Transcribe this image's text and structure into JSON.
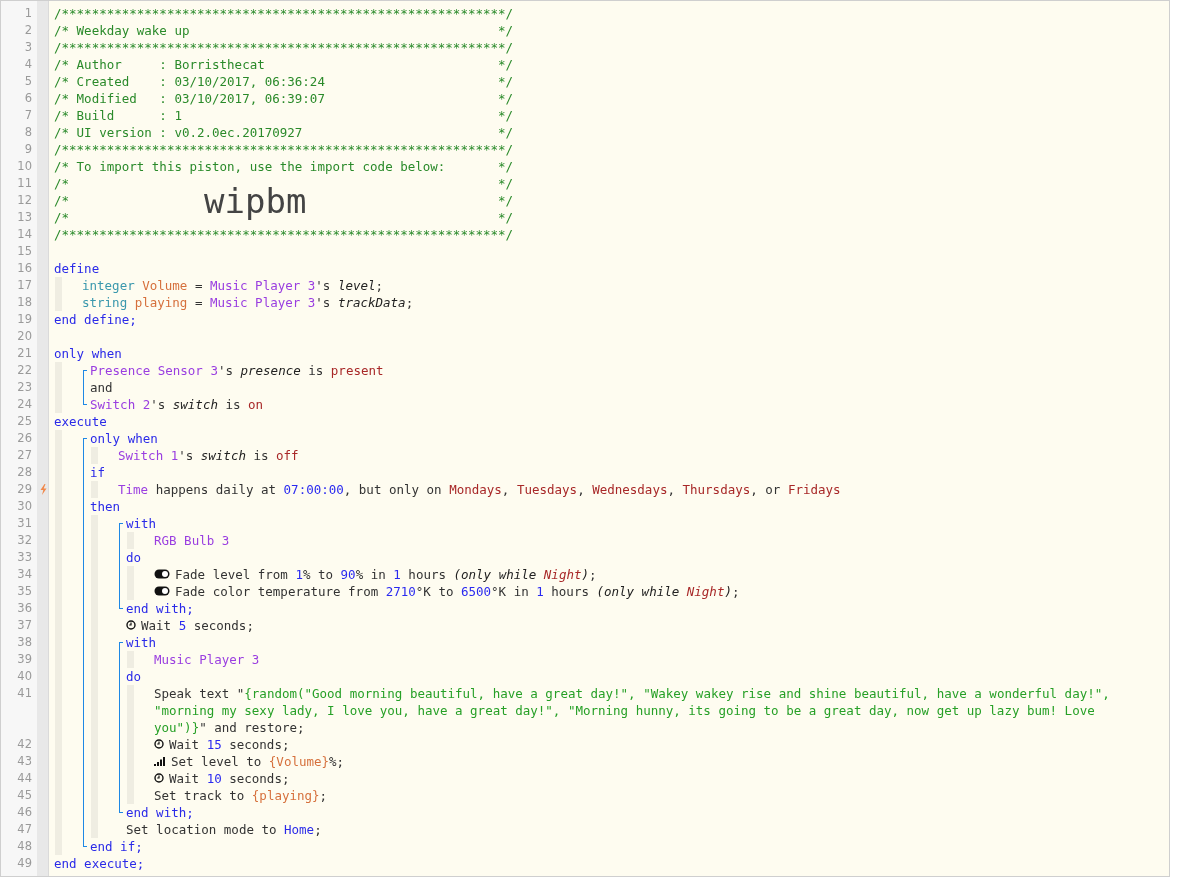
{
  "lines": [
    {
      "kind": "line",
      "n": "1",
      "tokens": [
        {
          "kind": "c",
          "t": "/***********************************************************/"
        }
      ]
    },
    {
      "kind": "banner",
      "n": "2",
      "tokens": [
        {
          "kind": "c",
          "t": "/* Weekday wake up"
        },
        {
          "kind": "c",
          "t": "*/"
        }
      ]
    },
    {
      "kind": "line",
      "n": "3",
      "tokens": [
        {
          "kind": "c",
          "t": "/***********************************************************/"
        }
      ]
    },
    {
      "kind": "banner",
      "n": "4",
      "tokens": [
        {
          "kind": "c",
          "t": "/* Author     : Borristhecat"
        },
        {
          "kind": "c",
          "t": "*/"
        }
      ]
    },
    {
      "kind": "banner",
      "n": "5",
      "tokens": [
        {
          "kind": "c",
          "t": "/* Created    : 03/10/2017, 06:36:24"
        },
        {
          "kind": "c",
          "t": "*/"
        }
      ]
    },
    {
      "kind": "banner",
      "n": "6",
      "tokens": [
        {
          "kind": "c",
          "t": "/* Modified   : 03/10/2017, 06:39:07"
        },
        {
          "kind": "c",
          "t": "*/"
        }
      ]
    },
    {
      "kind": "banner",
      "n": "7",
      "tokens": [
        {
          "kind": "c",
          "t": "/* Build      : 1"
        },
        {
          "kind": "c",
          "t": "*/"
        }
      ]
    },
    {
      "kind": "banner",
      "n": "8",
      "tokens": [
        {
          "kind": "c",
          "t": "/* UI version : v0.2.0ec.20170927"
        },
        {
          "kind": "c",
          "t": "*/"
        }
      ]
    },
    {
      "kind": "line",
      "n": "9",
      "tokens": [
        {
          "kind": "c",
          "t": "/***********************************************************/"
        }
      ]
    },
    {
      "kind": "banner",
      "n": "10",
      "tokens": [
        {
          "kind": "c",
          "t": "/* To import this piston, use the import code below:"
        },
        {
          "kind": "c",
          "t": "*/"
        }
      ]
    },
    {
      "kind": "banner",
      "n": "11",
      "tokens": [
        {
          "kind": "c",
          "t": "/*"
        },
        {
          "kind": "c",
          "t": "*/"
        }
      ]
    },
    {
      "kind": "banner",
      "n": "12",
      "tokens": [
        {
          "kind": "c",
          "t": "/*"
        },
        {
          "kind": "big",
          "t": "wipbm"
        },
        {
          "kind": "c",
          "t": "*/"
        }
      ]
    },
    {
      "kind": "banner",
      "n": "13",
      "tokens": [
        {
          "kind": "c",
          "t": "/*"
        },
        {
          "kind": "c",
          "t": "*/"
        }
      ]
    },
    {
      "kind": "line",
      "n": "14",
      "tokens": [
        {
          "kind": "c",
          "t": "/***********************************************************/"
        }
      ]
    },
    {
      "kind": "line",
      "n": "15"
    },
    {
      "kind": "line",
      "n": "16",
      "tokens": [
        {
          "kind": "kw",
          "t": "define"
        }
      ],
      "children": [
        {
          "kind": "line",
          "n": "17",
          "tokens": [
            {
              "kind": "type",
              "t": "integer "
            },
            {
              "kind": "var",
              "t": "Volume"
            },
            {
              "kind": "txt",
              "t": " = "
            },
            {
              "kind": "dev",
              "t": "Music Player 3"
            },
            {
              "kind": "txt",
              "t": "'s "
            },
            {
              "kind": "it",
              "t": "level"
            },
            {
              "kind": "txt",
              "t": ";"
            }
          ]
        },
        {
          "kind": "line",
          "n": "18",
          "tokens": [
            {
              "kind": "type",
              "t": "string "
            },
            {
              "kind": "var",
              "t": "playing"
            },
            {
              "kind": "txt",
              "t": " = "
            },
            {
              "kind": "dev",
              "t": "Music Player 3"
            },
            {
              "kind": "txt",
              "t": "'s "
            },
            {
              "kind": "it",
              "t": "trackData"
            },
            {
              "kind": "txt",
              "t": ";"
            }
          ]
        }
      ]
    },
    {
      "kind": "line",
      "n": "19",
      "tokens": [
        {
          "kind": "kw",
          "t": "end define;"
        }
      ]
    },
    {
      "kind": "line",
      "n": "20"
    },
    {
      "kind": "line",
      "n": "21",
      "tokens": [
        {
          "kind": "kw",
          "t": "only when"
        }
      ],
      "children": [
        {
          "kind": "group",
          "bracket": true,
          "items": [
            {
              "kind": "line",
              "n": "22",
              "tokens": [
                {
                  "kind": "dev",
                  "t": "Presence Sensor 3"
                },
                {
                  "kind": "txt",
                  "t": "'s "
                },
                {
                  "kind": "it",
                  "t": "presence"
                },
                {
                  "kind": "txt",
                  "t": " is "
                },
                {
                  "kind": "val",
                  "t": "present"
                }
              ]
            },
            {
              "kind": "line",
              "n": "23",
              "tokens": [
                {
                  "kind": "txt",
                  "t": "and"
                }
              ]
            },
            {
              "kind": "line",
              "n": "24",
              "tokens": [
                {
                  "kind": "dev",
                  "t": "Switch 2"
                },
                {
                  "kind": "txt",
                  "t": "'s "
                },
                {
                  "kind": "it",
                  "t": "switch"
                },
                {
                  "kind": "txt",
                  "t": " is "
                },
                {
                  "kind": "val",
                  "t": "on"
                }
              ]
            }
          ]
        }
      ]
    },
    {
      "kind": "line",
      "n": "25",
      "tokens": [
        {
          "kind": "kw",
          "t": "execute"
        }
      ],
      "children": [
        {
          "kind": "group",
          "bracket": true,
          "items": [
            {
              "kind": "line",
              "n": "26",
              "tokens": [
                {
                  "kind": "kw",
                  "t": "only when"
                }
              ],
              "children": [
                {
                  "kind": "line",
                  "n": "27",
                  "tokens": [
                    {
                      "kind": "dev",
                      "t": "Switch 1"
                    },
                    {
                      "kind": "txt",
                      "t": "'s "
                    },
                    {
                      "kind": "it",
                      "t": "switch"
                    },
                    {
                      "kind": "txt",
                      "t": " is "
                    },
                    {
                      "kind": "val",
                      "t": "off"
                    }
                  ]
                }
              ]
            },
            {
              "kind": "line",
              "n": "28",
              "tokens": [
                {
                  "kind": "kw",
                  "t": "if"
                }
              ],
              "children": [
                {
                  "kind": "line",
                  "n": "29",
                  "trigger": true,
                  "tokens": [
                    {
                      "kind": "dev",
                      "t": "Time"
                    },
                    {
                      "kind": "txt",
                      "t": " happens daily at "
                    },
                    {
                      "kind": "num",
                      "t": "07:00:00"
                    },
                    {
                      "kind": "txt",
                      "t": ", but only on "
                    },
                    {
                      "kind": "val",
                      "t": "Mondays"
                    },
                    {
                      "kind": "txt",
                      "t": ", "
                    },
                    {
                      "kind": "val",
                      "t": "Tuesdays"
                    },
                    {
                      "kind": "txt",
                      "t": ", "
                    },
                    {
                      "kind": "val",
                      "t": "Wednesdays"
                    },
                    {
                      "kind": "txt",
                      "t": ", "
                    },
                    {
                      "kind": "val",
                      "t": "Thursdays"
                    },
                    {
                      "kind": "txt",
                      "t": ", or "
                    },
                    {
                      "kind": "val",
                      "t": "Fridays"
                    }
                  ]
                }
              ]
            },
            {
              "kind": "line",
              "n": "30",
              "tokens": [
                {
                  "kind": "kw",
                  "t": "then"
                }
              ],
              "children": [
                {
                  "kind": "group",
                  "bracket": true,
                  "items": [
                    {
                      "kind": "line",
                      "n": "31",
                      "tokens": [
                        {
                          "kind": "kw",
                          "t": "with"
                        }
                      ],
                      "children": [
                        {
                          "kind": "line",
                          "n": "32",
                          "tokens": [
                            {
                              "kind": "dev",
                              "t": "RGB Bulb 3"
                            }
                          ]
                        }
                      ]
                    },
                    {
                      "kind": "line",
                      "n": "33",
                      "tokens": [
                        {
                          "kind": "kw",
                          "t": "do"
                        }
                      ],
                      "children": [
                        {
                          "kind": "line",
                          "n": "34",
                          "tokens": [
                            {
                              "kind": "icon_toggle"
                            },
                            {
                              "kind": "txt",
                              "t": "Fade level from "
                            },
                            {
                              "kind": "num",
                              "t": "1"
                            },
                            {
                              "kind": "txt",
                              "t": "% to "
                            },
                            {
                              "kind": "num",
                              "t": "90"
                            },
                            {
                              "kind": "txt",
                              "t": "% in "
                            },
                            {
                              "kind": "num",
                              "t": "1"
                            },
                            {
                              "kind": "txt",
                              "t": " hours "
                            },
                            {
                              "kind": "it",
                              "t": "(only while "
                            },
                            {
                              "kind": "itval",
                              "t": "Night"
                            },
                            {
                              "kind": "it",
                              "t": ")"
                            },
                            {
                              "kind": "txt",
                              "t": ";"
                            }
                          ]
                        },
                        {
                          "kind": "line",
                          "n": "35",
                          "tokens": [
                            {
                              "kind": "icon_toggle"
                            },
                            {
                              "kind": "txt",
                              "t": "Fade color temperature from "
                            },
                            {
                              "kind": "num",
                              "t": "2710"
                            },
                            {
                              "kind": "txt",
                              "t": "°K to "
                            },
                            {
                              "kind": "num",
                              "t": "6500"
                            },
                            {
                              "kind": "txt",
                              "t": "°K in "
                            },
                            {
                              "kind": "num",
                              "t": "1"
                            },
                            {
                              "kind": "txt",
                              "t": " hours "
                            },
                            {
                              "kind": "it",
                              "t": "(only while "
                            },
                            {
                              "kind": "itval",
                              "t": "Night"
                            },
                            {
                              "kind": "it",
                              "t": ")"
                            },
                            {
                              "kind": "txt",
                              "t": ";"
                            }
                          ]
                        }
                      ]
                    },
                    {
                      "kind": "line",
                      "n": "36",
                      "tokens": [
                        {
                          "kind": "kw",
                          "t": "end with;"
                        }
                      ]
                    }
                  ]
                },
                {
                  "kind": "group",
                  "bracket": false,
                  "items": [
                    {
                      "kind": "line",
                      "n": "37",
                      "tokens": [
                        {
                          "kind": "icon_clock"
                        },
                        {
                          "kind": "txt",
                          "t": "Wait "
                        },
                        {
                          "kind": "num",
                          "t": "5"
                        },
                        {
                          "kind": "txt",
                          "t": " seconds;"
                        }
                      ]
                    }
                  ]
                },
                {
                  "kind": "group",
                  "bracket": true,
                  "items": [
                    {
                      "kind": "line",
                      "n": "38",
                      "tokens": [
                        {
                          "kind": "kw",
                          "t": "with"
                        }
                      ],
                      "children": [
                        {
                          "kind": "line",
                          "n": "39",
                          "tokens": [
                            {
                              "kind": "dev",
                              "t": "Music Player 3"
                            }
                          ]
                        }
                      ]
                    },
                    {
                      "kind": "line",
                      "n": "40",
                      "tokens": [
                        {
                          "kind": "kw",
                          "t": "do"
                        }
                      ],
                      "children": [
                        {
                          "kind": "line",
                          "n": "41",
                          "tokens": [
                            {
                              "kind": "txt",
                              "t": "Speak text \""
                            },
                            {
                              "kind": "str",
                              "t": "{random(\"Good morning beautiful, have a great day!\", \"Wakey wakey rise and shine beautiful, have a wonderful day!\", \"morning my sexy lady, I love you, have a great day!\", \"Morning hunny, its going to be a great day, now get up lazy bum! Love you\")}"
                            },
                            {
                              "kind": "txt",
                              "t": "\" and restore;"
                            }
                          ]
                        },
                        {
                          "kind": "line",
                          "n": "42",
                          "tokens": [
                            {
                              "kind": "icon_clock"
                            },
                            {
                              "kind": "txt",
                              "t": "Wait "
                            },
                            {
                              "kind": "num",
                              "t": "15"
                            },
                            {
                              "kind": "txt",
                              "t": " seconds;"
                            }
                          ]
                        },
                        {
                          "kind": "line",
                          "n": "43",
                          "tokens": [
                            {
                              "kind": "icon_bars"
                            },
                            {
                              "kind": "txt",
                              "t": "Set level to "
                            },
                            {
                              "kind": "var",
                              "t": "{Volume}"
                            },
                            {
                              "kind": "txt",
                              "t": "%;"
                            }
                          ]
                        },
                        {
                          "kind": "line",
                          "n": "44",
                          "tokens": [
                            {
                              "kind": "icon_clock"
                            },
                            {
                              "kind": "txt",
                              "t": "Wait "
                            },
                            {
                              "kind": "num",
                              "t": "10"
                            },
                            {
                              "kind": "txt",
                              "t": " seconds;"
                            }
                          ]
                        },
                        {
                          "kind": "line",
                          "n": "45",
                          "tokens": [
                            {
                              "kind": "txt",
                              "t": "Set track to "
                            },
                            {
                              "kind": "var",
                              "t": "{playing}"
                            },
                            {
                              "kind": "txt",
                              "t": ";"
                            }
                          ]
                        }
                      ]
                    },
                    {
                      "kind": "line",
                      "n": "46",
                      "tokens": [
                        {
                          "kind": "kw",
                          "t": "end with;"
                        }
                      ]
                    }
                  ]
                },
                {
                  "kind": "group",
                  "bracket": false,
                  "items": [
                    {
                      "kind": "line",
                      "n": "47",
                      "tokens": [
                        {
                          "kind": "txt",
                          "t": "Set location mode to "
                        },
                        {
                          "kind": "kw",
                          "t": "Home"
                        },
                        {
                          "kind": "txt",
                          "t": ";"
                        }
                      ]
                    }
                  ]
                }
              ]
            },
            {
              "kind": "line",
              "n": "48",
              "tokens": [
                {
                  "kind": "kw",
                  "t": "end if;"
                }
              ]
            }
          ]
        }
      ]
    },
    {
      "kind": "line",
      "n": "49",
      "tokens": [
        {
          "kind": "kw",
          "t": "end execute;"
        }
      ]
    }
  ]
}
